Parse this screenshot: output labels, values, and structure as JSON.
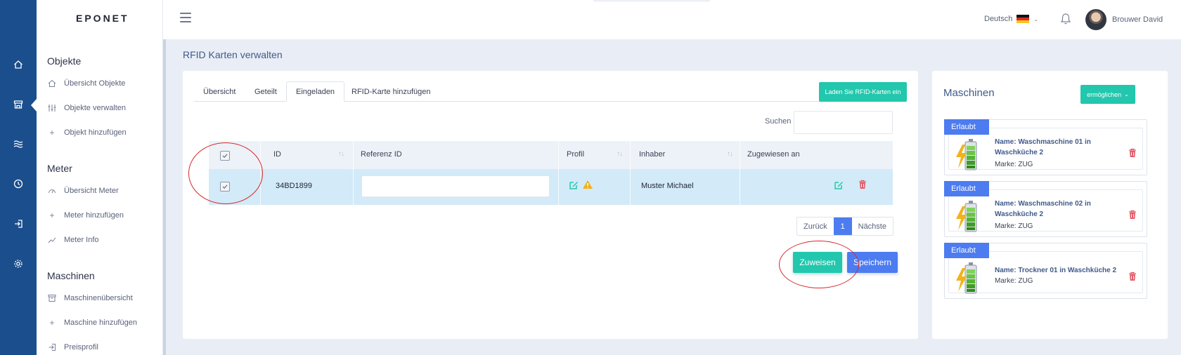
{
  "app": {
    "logo": "EPONET"
  },
  "topbar": {
    "language": "Deutsch",
    "user_name": "Brouwer David"
  },
  "sidebar": {
    "sections": [
      {
        "title": "Objekte",
        "items": [
          {
            "label": "Übersicht Objekte",
            "icon": "home-icon"
          },
          {
            "label": "Objekte verwalten",
            "icon": "sliders-icon"
          },
          {
            "label": "Objekt hinzufügen",
            "icon": "plus-icon"
          }
        ]
      },
      {
        "title": "Meter",
        "items": [
          {
            "label": "Übersicht Meter",
            "icon": "gauge-icon"
          },
          {
            "label": "Meter hinzufügen",
            "icon": "plus-icon"
          },
          {
            "label": "Meter Info",
            "icon": "trend-icon"
          }
        ]
      },
      {
        "title": "Maschinen",
        "items": [
          {
            "label": "Maschinenübersicht",
            "icon": "archive-icon"
          },
          {
            "label": "Maschine hinzufügen",
            "icon": "plus-icon"
          },
          {
            "label": "Preisprofil",
            "icon": "login-icon"
          }
        ]
      }
    ]
  },
  "page": {
    "title": "RFID Karten verwalten"
  },
  "main": {
    "tabs": [
      "Übersicht",
      "Geteilt",
      "Eingeladen",
      "RFID-Karte hinzufügen"
    ],
    "active_tab": "Eingeladen",
    "load_button": "Laden Sie RFID-Karten ein",
    "search_label": "Suchen",
    "search_value": "",
    "table": {
      "headers": [
        "ID",
        "Referenz ID",
        "Profil",
        "Inhaber",
        "Zugewiesen an"
      ],
      "rows": [
        {
          "id": "34BD1899",
          "referenz_id": "",
          "inhaber": "Muster Michael",
          "zugewiesen_an": ""
        }
      ]
    },
    "pager": {
      "prev": "Zurück",
      "current": "1",
      "next": "Nächste"
    },
    "assign_button": "Zuweisen",
    "save_button": "Speichern"
  },
  "machines": {
    "title": "Maschinen",
    "enable_button": "ermöglichen",
    "items": [
      {
        "badge": "Erlaubt",
        "name": "Name: Waschmaschine 01 in Waschküche 2",
        "brand": "Marke: ZUG"
      },
      {
        "badge": "Erlaubt",
        "name": "Name: Waschmaschine 02 in Waschküche 2",
        "brand": "Marke: ZUG"
      },
      {
        "badge": "Erlaubt",
        "name": "Name: Trockner 01 in Waschküche 2",
        "brand": "Marke: ZUG"
      }
    ]
  },
  "colors": {
    "rail": "#1b4e8c",
    "teal": "#22c7ad",
    "blue": "#4c7cf0",
    "row_highlight": "#d3eaf8",
    "annotation": "#d8282a",
    "danger": "#e35d6a",
    "warning": "#f2b21b"
  }
}
